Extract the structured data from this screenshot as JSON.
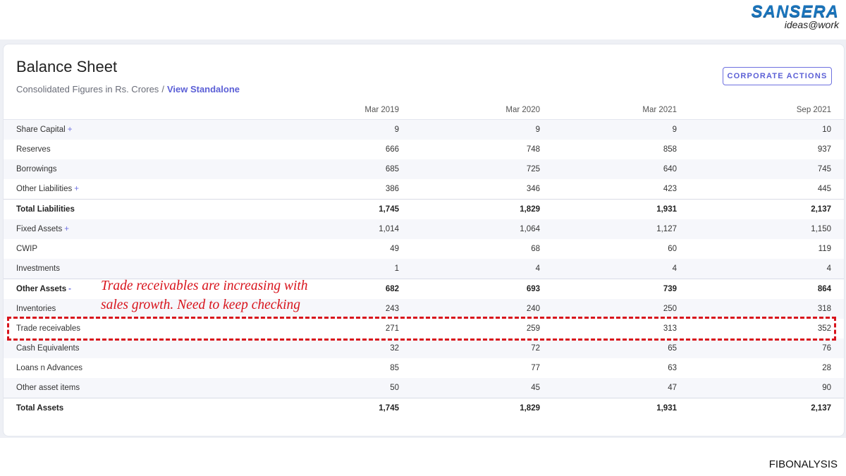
{
  "brand": {
    "name": "SANSERA",
    "tagline": "ideas@work"
  },
  "header": {
    "title": "Balance Sheet",
    "subtitle_prefix": "Consolidated Figures in Rs. Crores",
    "subtitle_sep": "/",
    "view_link": "View Standalone",
    "corporate_button": "CORPORATE ACTIONS"
  },
  "table": {
    "columns": [
      "Mar 2019",
      "Mar 2020",
      "Mar 2021",
      "Sep 2021"
    ],
    "rows": [
      {
        "label": "Share Capital",
        "expand": "+",
        "values": [
          "9",
          "9",
          "9",
          "10"
        ]
      },
      {
        "label": "Reserves",
        "values": [
          "666",
          "748",
          "858",
          "937"
        ]
      },
      {
        "label": "Borrowings",
        "values": [
          "685",
          "725",
          "640",
          "745"
        ]
      },
      {
        "label": "Other Liabilities",
        "expand": "+",
        "values": [
          "386",
          "346",
          "423",
          "445"
        ]
      },
      {
        "label": "Total Liabilities",
        "values": [
          "1,745",
          "1,829",
          "1,931",
          "2,137"
        ]
      },
      {
        "label": "Fixed Assets",
        "expand": "+",
        "values": [
          "1,014",
          "1,064",
          "1,127",
          "1,150"
        ]
      },
      {
        "label": "CWIP",
        "values": [
          "49",
          "68",
          "60",
          "119"
        ]
      },
      {
        "label": "Investments",
        "values": [
          "1",
          "4",
          "4",
          "4"
        ]
      },
      {
        "label": "Other Assets",
        "expand": "-",
        "values": [
          "682",
          "693",
          "739",
          "864"
        ]
      },
      {
        "label": "Inventories",
        "values": [
          "243",
          "240",
          "250",
          "318"
        ]
      },
      {
        "label": "Trade receivables",
        "values": [
          "271",
          "259",
          "313",
          "352"
        ]
      },
      {
        "label": "Cash Equivalents",
        "values": [
          "32",
          "72",
          "65",
          "76"
        ]
      },
      {
        "label": "Loans n Advances",
        "values": [
          "85",
          "77",
          "63",
          "28"
        ]
      },
      {
        "label": "Other asset items",
        "values": [
          "50",
          "45",
          "47",
          "90"
        ]
      },
      {
        "label": "Total Assets",
        "values": [
          "1,745",
          "1,829",
          "1,931",
          "2,137"
        ]
      }
    ]
  },
  "annotation": {
    "line1": "Trade receivables are increasing with",
    "line2": "sales growth. Need  to keep checking"
  },
  "footer": {
    "text": "FIBONALYSIS"
  },
  "colors": {
    "accent": "#5b5fd6",
    "annotation": "#d8141c",
    "brand": "#1b75bc"
  }
}
